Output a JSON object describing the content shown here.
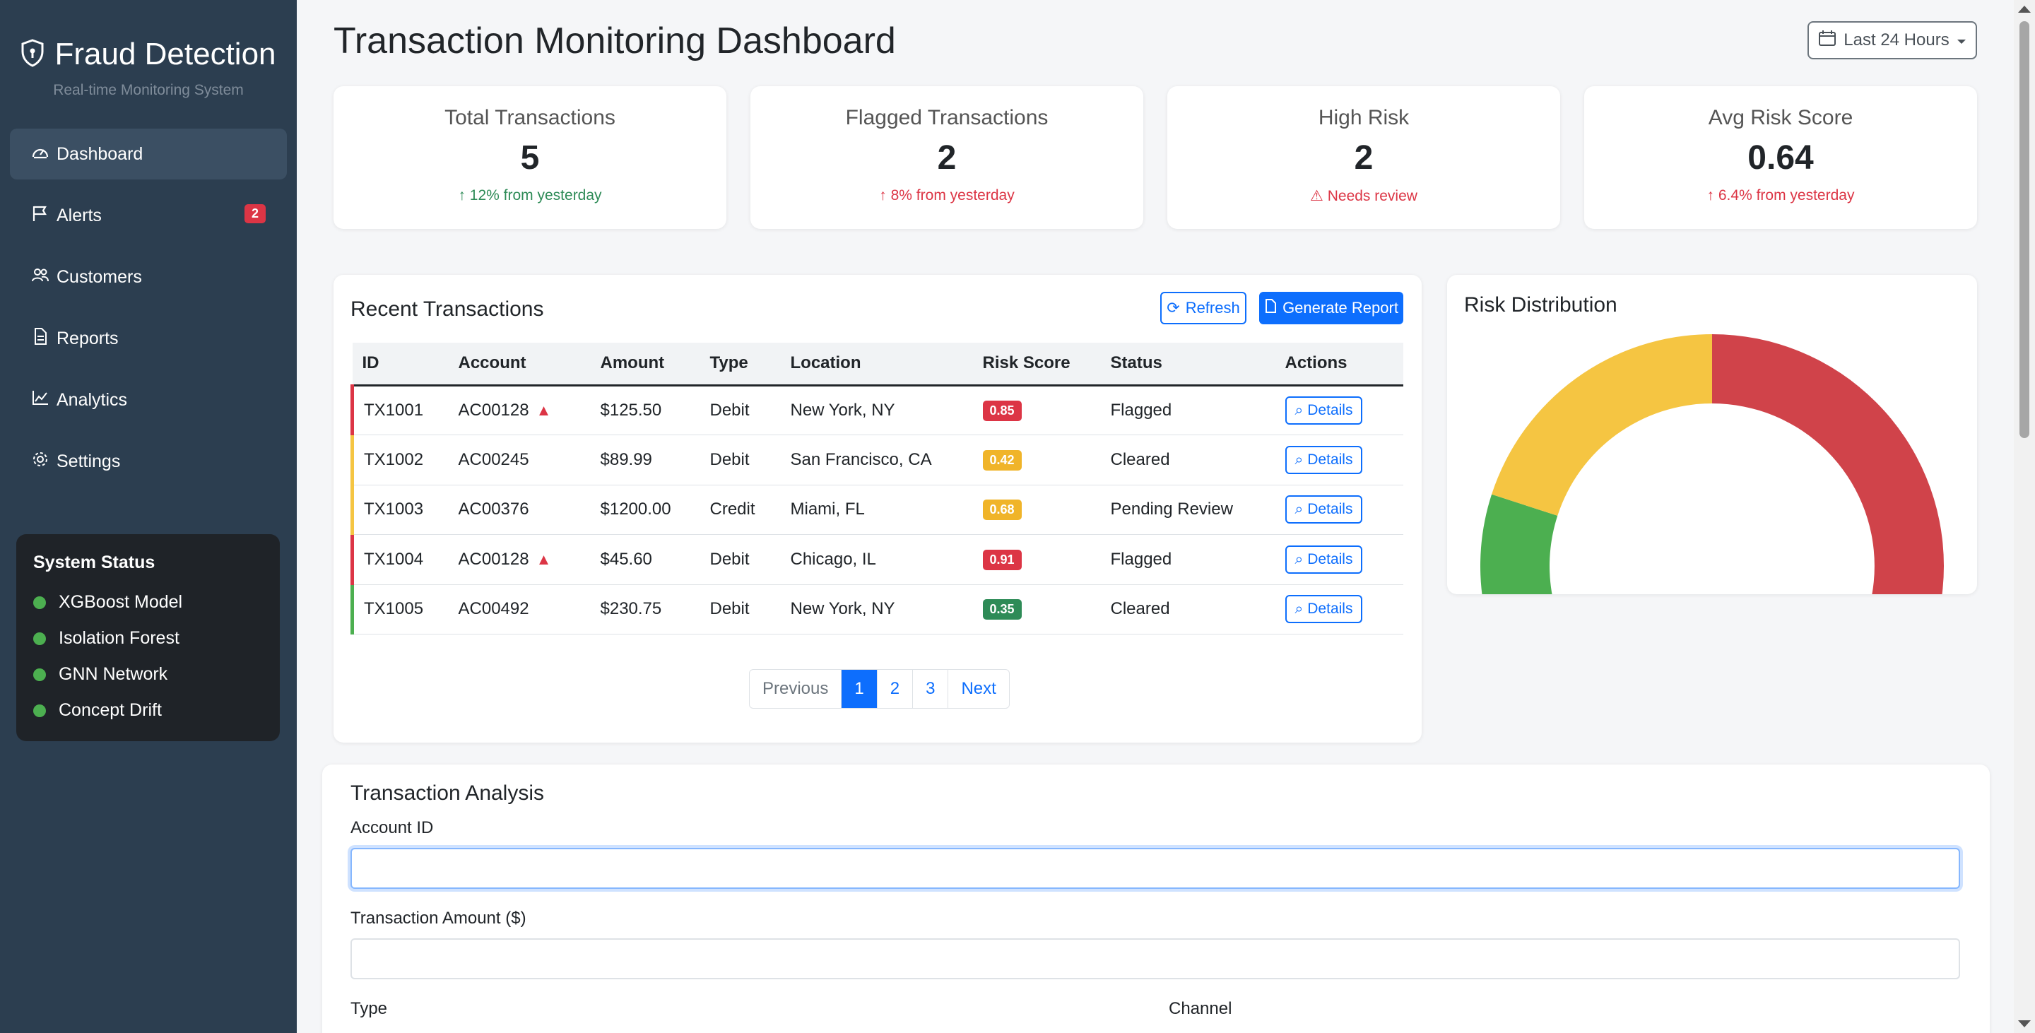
{
  "sidebar": {
    "brand_title": "Fraud Detection",
    "brand_subtitle": "Real-time Monitoring System",
    "items": [
      {
        "label": "Dashboard",
        "icon": "speedometer-icon",
        "active": true
      },
      {
        "label": "Alerts",
        "icon": "flag-icon",
        "badge": "2"
      },
      {
        "label": "Customers",
        "icon": "people-icon"
      },
      {
        "label": "Reports",
        "icon": "file-icon"
      },
      {
        "label": "Analytics",
        "icon": "graph-icon"
      },
      {
        "label": "Settings",
        "icon": "gear-icon"
      }
    ],
    "system_status": {
      "title": "System Status",
      "items": [
        "XGBoost Model",
        "Isolation Forest",
        "GNN Network",
        "Concept Drift"
      ],
      "status_color": "#4caf50"
    }
  },
  "header": {
    "title": "Transaction Monitoring Dashboard",
    "range_label": "Last 24 Hours"
  },
  "stats": [
    {
      "label": "Total Transactions",
      "value": "5",
      "change": "12% from yesterday",
      "tone": "good"
    },
    {
      "label": "Flagged Transactions",
      "value": "2",
      "change": "8% from yesterday",
      "tone": "bad"
    },
    {
      "label": "High Risk",
      "value": "2",
      "change": "Needs review",
      "tone": "bad"
    },
    {
      "label": "Avg Risk Score",
      "value": "0.64",
      "change": "6.4% from yesterday",
      "tone": "bad"
    }
  ],
  "recent": {
    "title": "Recent Transactions",
    "refresh_label": "Refresh",
    "report_label": "Generate Report",
    "columns": [
      "ID",
      "Account",
      "Amount",
      "Type",
      "Location",
      "Risk Score",
      "Status",
      "Actions"
    ],
    "rows": [
      {
        "id": "TX1001",
        "account": "AC00128",
        "warn": true,
        "amount": "$125.50",
        "type": "Debit",
        "location": "New York, NY",
        "risk": "0.85",
        "risk_color": "#dc3545",
        "status": "Flagged",
        "action": "Details",
        "border": "#dc3545"
      },
      {
        "id": "TX1002",
        "account": "AC00245",
        "warn": false,
        "amount": "$89.99",
        "type": "Debit",
        "location": "San Francisco, CA",
        "risk": "0.42",
        "risk_color": "#f0b429",
        "status": "Cleared",
        "action": "Details",
        "border": "#f5c542"
      },
      {
        "id": "TX1003",
        "account": "AC00376",
        "warn": false,
        "amount": "$1200.00",
        "type": "Credit",
        "location": "Miami, FL",
        "risk": "0.68",
        "risk_color": "#f0b429",
        "status": "Pending Review",
        "action": "Details",
        "border": "#f5c542"
      },
      {
        "id": "TX1004",
        "account": "AC00128",
        "warn": true,
        "amount": "$45.60",
        "type": "Debit",
        "location": "Chicago, IL",
        "risk": "0.91",
        "risk_color": "#dc3545",
        "status": "Flagged",
        "action": "Details",
        "border": "#dc3545"
      },
      {
        "id": "TX1005",
        "account": "AC00492",
        "warn": false,
        "amount": "$230.75",
        "type": "Debit",
        "location": "New York, NY",
        "risk": "0.35",
        "risk_color": "#2e8b57",
        "status": "Cleared",
        "action": "Details",
        "border": "#4caf50"
      }
    ],
    "pagination": {
      "previous": "Previous",
      "pages": [
        "1",
        "2",
        "3"
      ],
      "current": "1",
      "next": "Next"
    }
  },
  "risk_distribution": {
    "title": "Risk Distribution",
    "chart_data": {
      "type": "pie",
      "series": [
        {
          "value": 50,
          "color": "#d0434a"
        },
        {
          "value": 30,
          "color": "#4caf50"
        },
        {
          "value": 20,
          "color": "#f5c542"
        }
      ]
    }
  },
  "analysis": {
    "title": "Transaction Analysis",
    "account_label": "Account ID",
    "account_value": "",
    "amount_label": "Transaction Amount ($)",
    "amount_value": "",
    "type_label": "Type",
    "channel_label": "Channel"
  },
  "colors": {
    "primary": "#0d6efd",
    "sidebar": "#2c3e50",
    "danger": "#dc3545",
    "success": "#2e8b57"
  }
}
